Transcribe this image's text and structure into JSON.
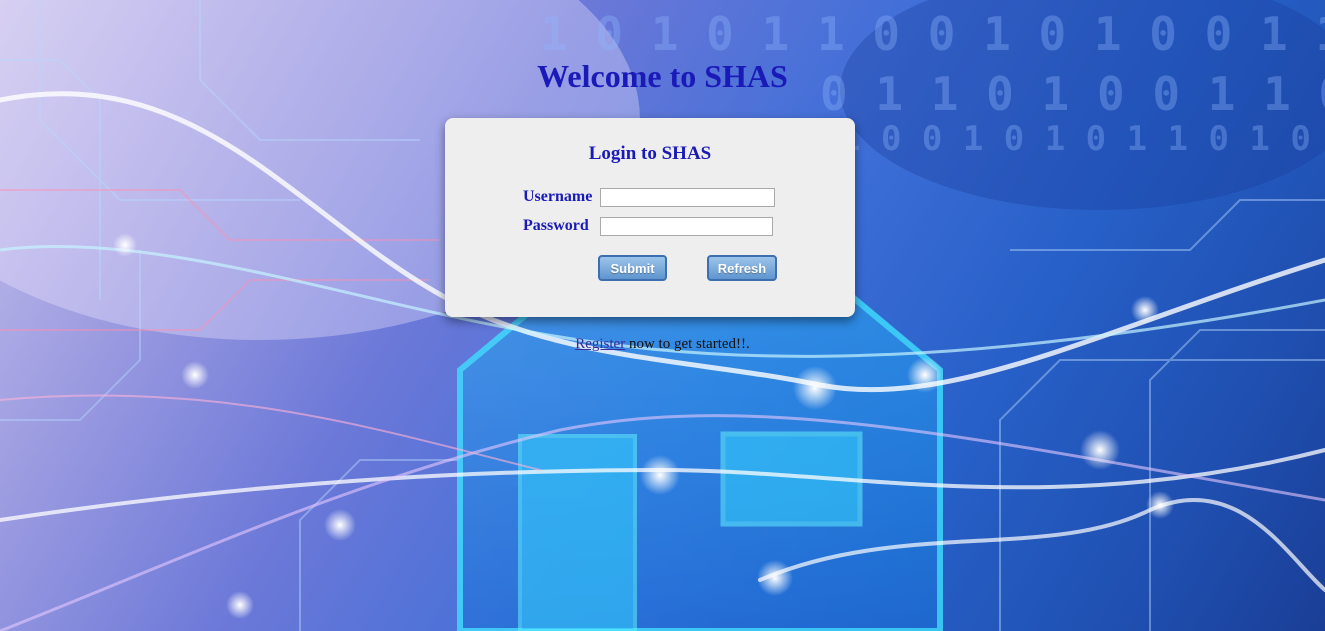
{
  "page": {
    "title": "Welcome to SHAS"
  },
  "login": {
    "title": "Login to SHAS",
    "username_label": "Username",
    "password_label": "Password",
    "username_value": "",
    "password_value": "",
    "submit_label": "Submit",
    "refresh_label": "Refresh"
  },
  "register": {
    "link_text": "Register",
    "trailing_text": " now to get started!!."
  },
  "colors": {
    "title": "#1a1ab8",
    "panel_bg": "#eeeeee",
    "button": "#6a9fd6"
  }
}
